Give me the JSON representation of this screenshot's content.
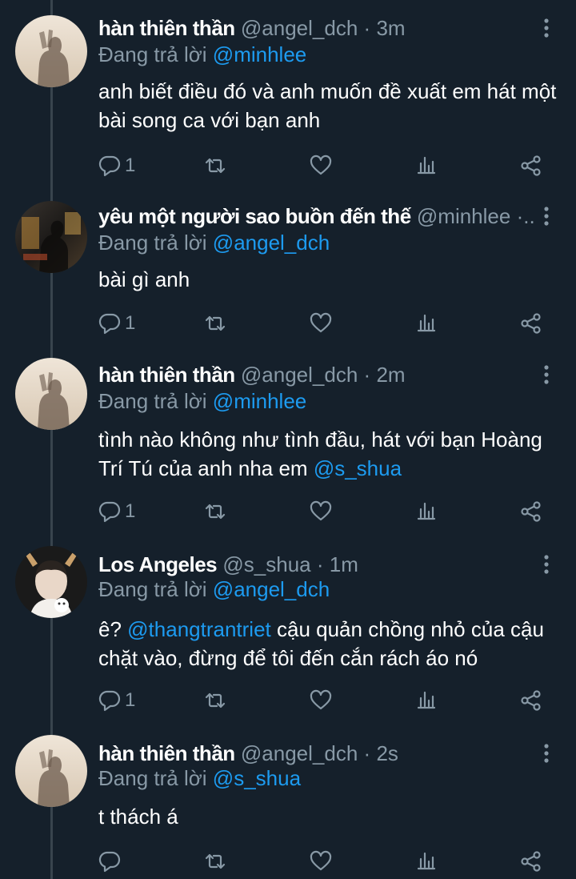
{
  "reply_prefix": "Đang trả lời",
  "colors": {
    "background": "#15202b",
    "secondary_text": "#8899a6",
    "link": "#1d9bf0",
    "thread_line": "#38444d"
  },
  "tweets": [
    {
      "author": "hàn thiên thần",
      "handle": "@angel_dch",
      "dot": "·",
      "time": "3m",
      "avatar_icon": "sepia-silhouette-avatar",
      "reply_to": "@minhlee",
      "text_parts": [
        "anh biết điều đó và anh muốn đề xuất em hát một bài song ca với bạn anh"
      ],
      "reply_count": "1"
    },
    {
      "author": "yêu một người sao buồn đến thế",
      "handle": "@minhlee",
      "dot": "·...",
      "time": "",
      "avatar_icon": "dark-photo-avatar",
      "reply_to": "@angel_dch",
      "text_parts": [
        "bài gì anh"
      ],
      "reply_count": "1"
    },
    {
      "author": "hàn thiên thần",
      "handle": "@angel_dch",
      "dot": "·",
      "time": "2m",
      "avatar_icon": "sepia-silhouette-avatar",
      "reply_to": "@minhlee",
      "text_parts": [
        "tình nào không như tình đầu, hát với bạn Hoàng Trí Tú của anh nha em ",
        "@s_shua"
      ],
      "reply_count": "1"
    },
    {
      "author": "Los Angeles",
      "handle": "@s_shua",
      "dot": "·",
      "time": "1m",
      "avatar_icon": "person-with-deer-ears-avatar",
      "reply_to": "@angel_dch",
      "text_parts": [
        "ê? ",
        "@thangtrantriet",
        " cậu quản chồng nhỏ của cậu chặt vào, đừng để tôi đến cắn rách áo nó"
      ],
      "reply_count": "1"
    },
    {
      "author": "hàn thiên thần",
      "handle": "@angel_dch",
      "dot": "·",
      "time": "2s",
      "avatar_icon": "sepia-silhouette-avatar",
      "reply_to": "@s_shua",
      "text_parts": [
        "t thách á"
      ],
      "reply_count": ""
    }
  ],
  "action_icons": [
    "reply-icon",
    "retweet-icon",
    "like-icon",
    "analytics-icon",
    "share-icon"
  ]
}
